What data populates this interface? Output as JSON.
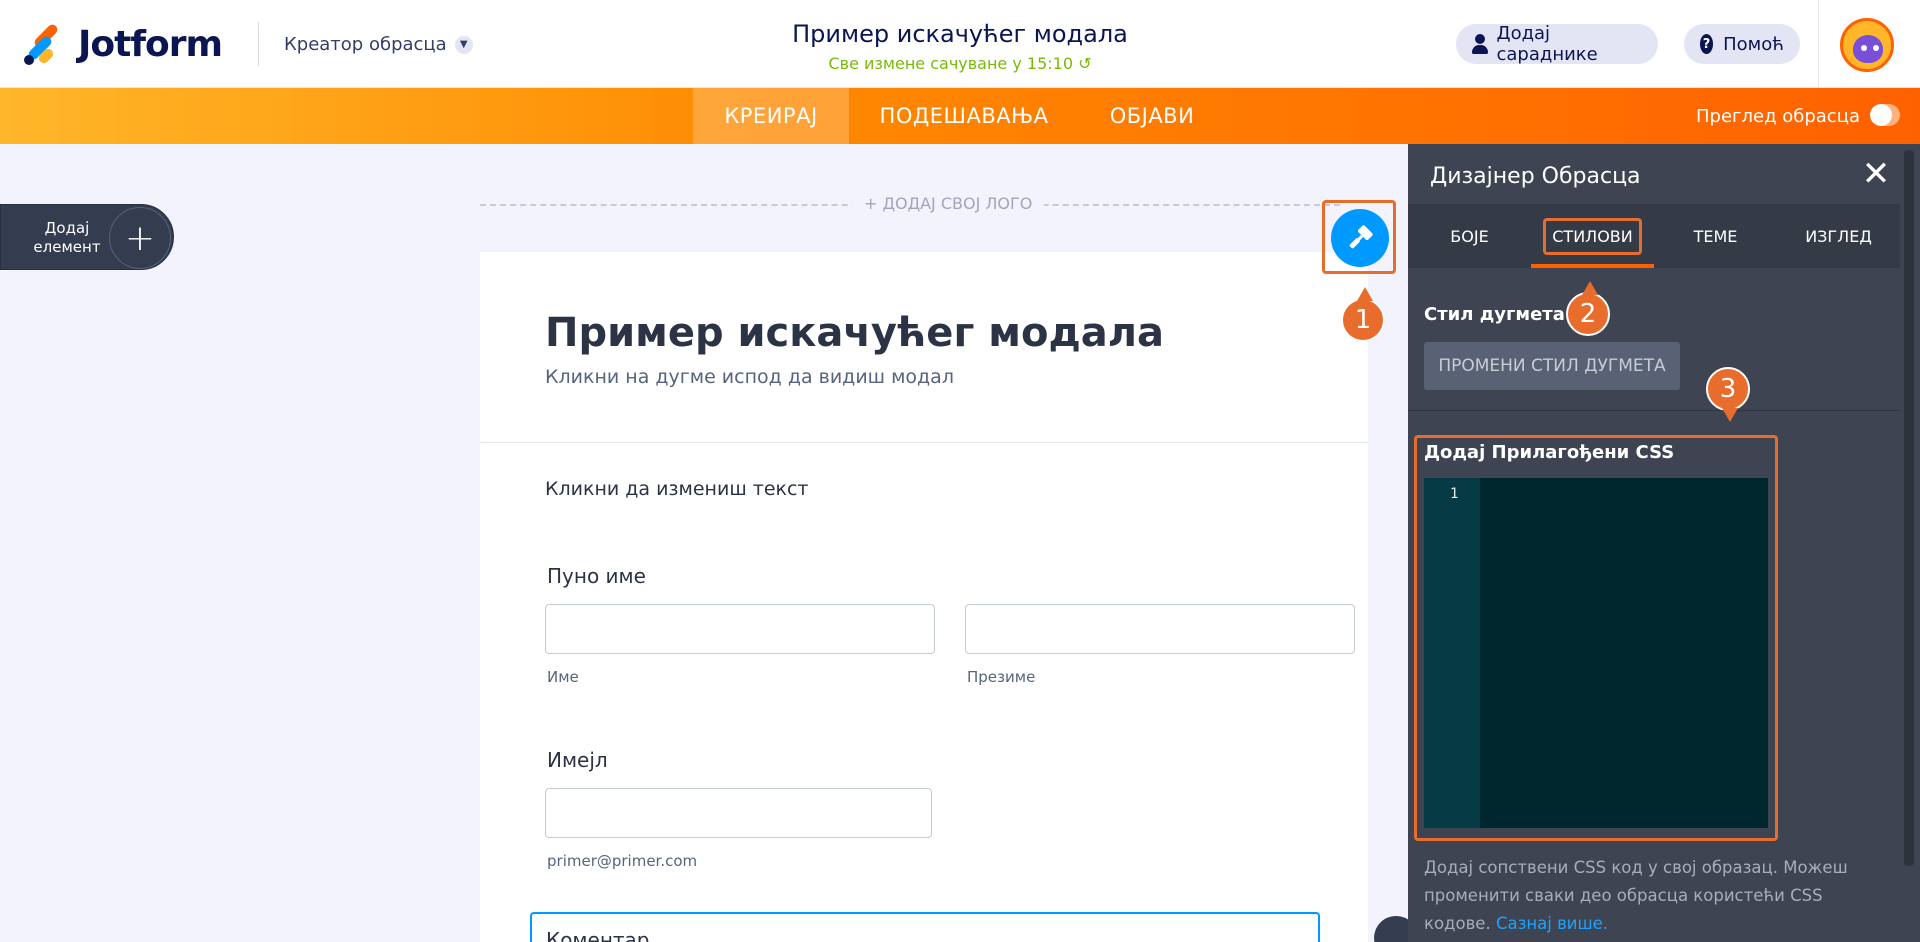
{
  "header": {
    "logo_text": "Jotform",
    "creator_label": "Креатор обрасца",
    "form_title": "Пример искачућег модала",
    "saved_status": "Све измене сачуване у 15:10",
    "add_collaborators": "Додај сараднике",
    "help": "Помоћ"
  },
  "nav": {
    "tabs": [
      "КРЕИРАЈ",
      "ПОДЕШАВАЊА",
      "ОБЈАВИ"
    ],
    "active_tab": "КРЕИРАЈ",
    "preview_label": "Преглед обрасца"
  },
  "canvas": {
    "add_element_label": "Додај елемент",
    "add_logo": "+ ДОДАЈ СВОЈ ЛОГО",
    "form": {
      "title": "Пример искачућег модала",
      "subtitle": "Кликни на дугме испод да видиш модал",
      "text": "Кликни да измениш текст",
      "fullname_label": "Пуно име",
      "first_name_hint": "Име",
      "last_name_hint": "Презиме",
      "email_label": "Имејл",
      "email_hint": "primer@primer.com",
      "comment_label": "Коментар"
    }
  },
  "callouts": [
    "1",
    "2",
    "3"
  ],
  "designer": {
    "title": "Дизајнер Обрасца",
    "tabs": [
      "БОЈЕ",
      "СТИЛОВИ",
      "ТЕМЕ",
      "ИЗГЛЕД"
    ],
    "active_tab": "СТИЛОВИ",
    "button_style_title": "Стил дугмета",
    "change_button_style": "ПРОМЕНИ СТИЛ ДУГМЕТА",
    "custom_css_title": "Додај Прилагођени CSS",
    "line_number": "1",
    "description": "Додај сопствени CSS код у свој образац. Можеш променити сваки део обрасца користећи CSS кодове.",
    "learn_more": "Сазнај више."
  },
  "colors": {
    "brand_orange": "#ff6100",
    "callout_orange": "#e86d2c",
    "accent_blue": "#0099ff",
    "saved_green": "#78bb07",
    "panel_bg": "#3e4451",
    "code_bg": "#00262e"
  },
  "icons": {
    "close": "close-icon",
    "paint": "paint-roller-icon",
    "history": "history-icon",
    "user": "user-icon",
    "help": "question-icon"
  }
}
